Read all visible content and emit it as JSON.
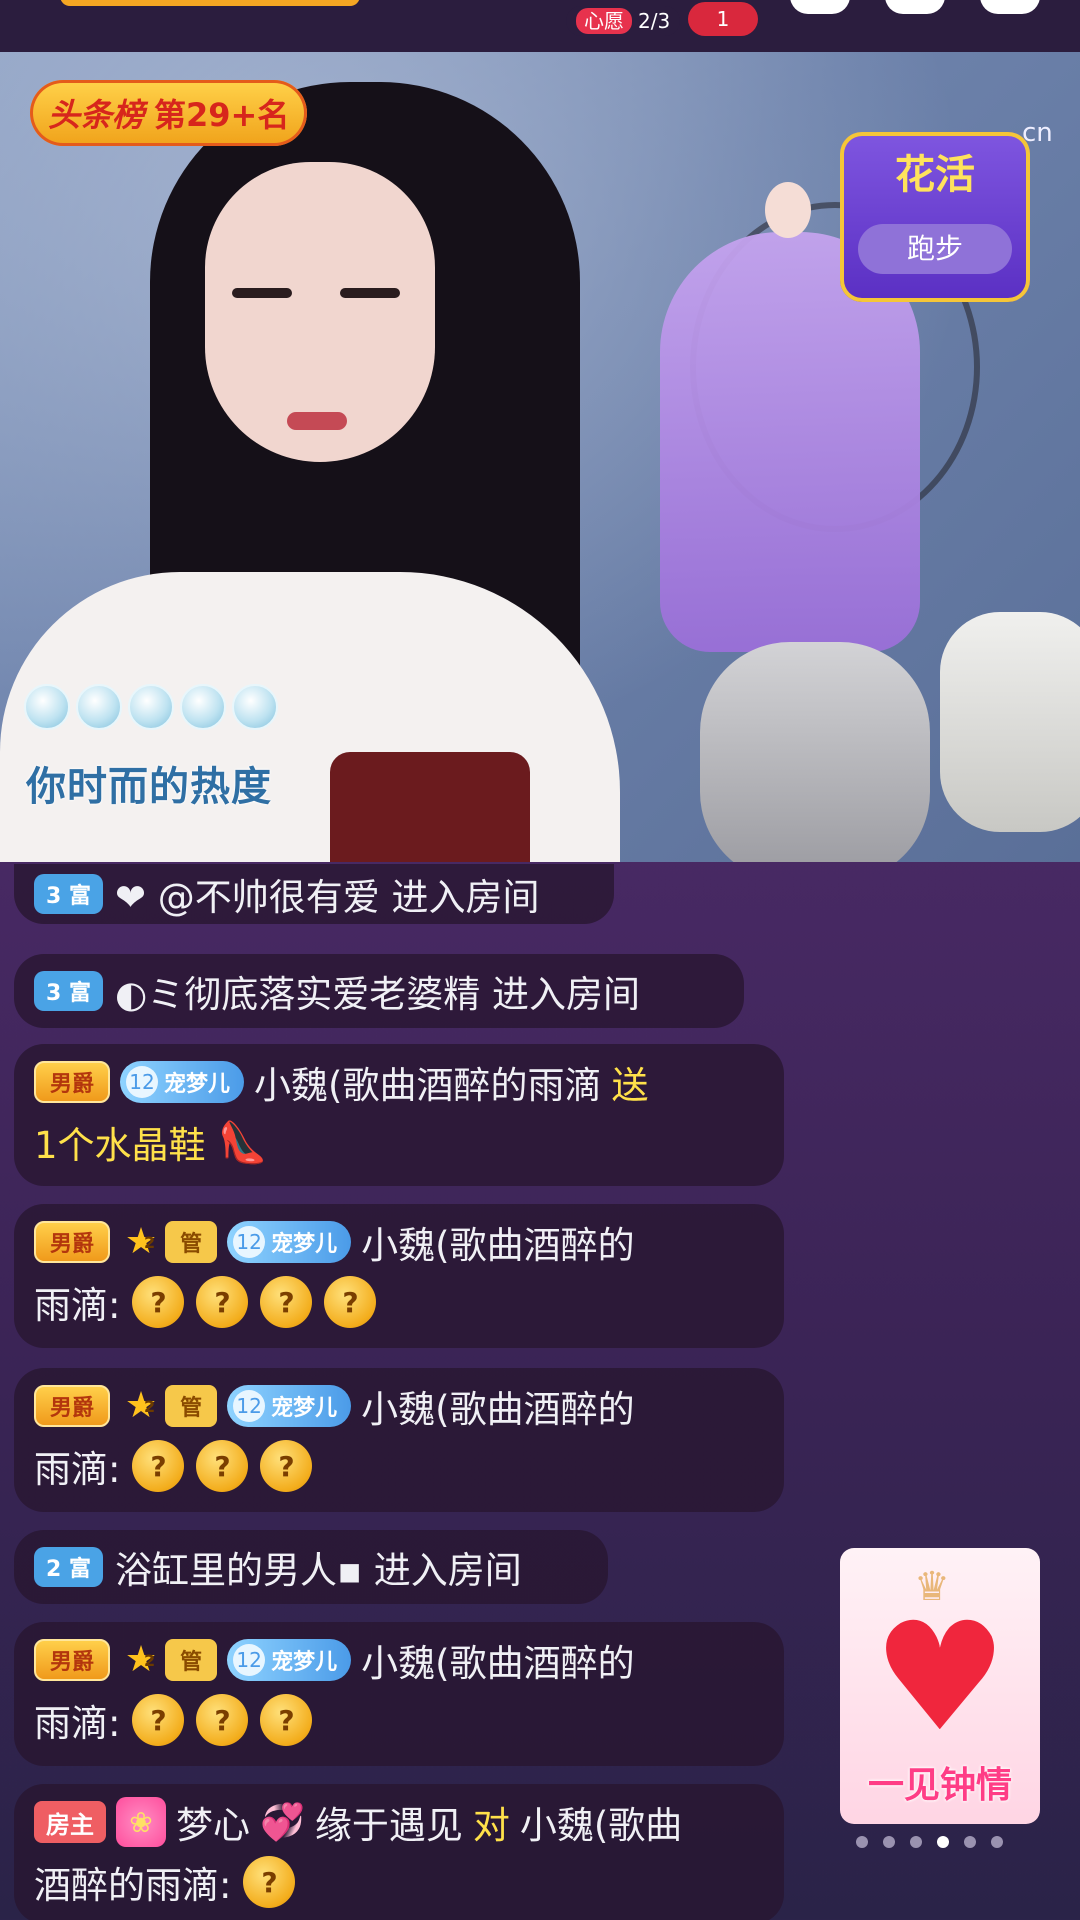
{
  "top_bar": {
    "wish_label": "心愿",
    "wish_count": "2/3",
    "heart_count": "1"
  },
  "video": {
    "rank_badge": {
      "label": "头条榜",
      "value": "第29+名"
    },
    "activity": {
      "title": "花活",
      "button": "跑步"
    },
    "watermark": "cn",
    "heat_caption": "你时而的热度"
  },
  "chat": {
    "messages": [
      {
        "badge": "3 富",
        "text": "❤ @不帅很有爱 进入房间"
      },
      {
        "badge": "3 富",
        "text": "◐ミ彻底落实爱老婆精 进入房间"
      },
      {
        "noble": "男爵",
        "fan_name": "宠梦儿",
        "fan_level": "12",
        "user": "小魏(歌曲酒醉的雨滴",
        "gift_word": "送",
        "gift_line": "1个水晶鞋"
      },
      {
        "noble": "男爵",
        "star_level": "2",
        "admin": "管",
        "fan_name": "宠梦儿",
        "fan_level": "12",
        "user": "小魏(歌曲酒醉的",
        "line2": "雨滴:",
        "emoji_count": 4
      },
      {
        "noble": "男爵",
        "star_level": "2",
        "admin": "管",
        "fan_name": "宠梦儿",
        "fan_level": "12",
        "user": "小魏(歌曲酒醉的",
        "line2": "雨滴:",
        "emoji_count": 3
      },
      {
        "badge": "2 富",
        "text": "浴缸里的男人▪ 进入房间"
      },
      {
        "noble": "男爵",
        "star_level": "2",
        "admin": "管",
        "fan_name": "宠梦儿",
        "fan_level": "12",
        "user": "小魏(歌曲酒醉的",
        "line2": "雨滴:",
        "emoji_count": 3
      },
      {
        "host_badge": "房主",
        "sender": "梦心",
        "sender_suffix": "缘于遇见",
        "to_word": "对",
        "target": "小魏(歌曲",
        "line2": "酒醉的雨滴:",
        "emoji_count": 1
      }
    ]
  },
  "promo": {
    "label": "一见钟情"
  },
  "pager": {
    "count": 6,
    "active": 3
  },
  "colors": {
    "accent": "#ffe14a",
    "rich_badge": "#4aa3e6",
    "host_badge": "#ef5e63"
  }
}
